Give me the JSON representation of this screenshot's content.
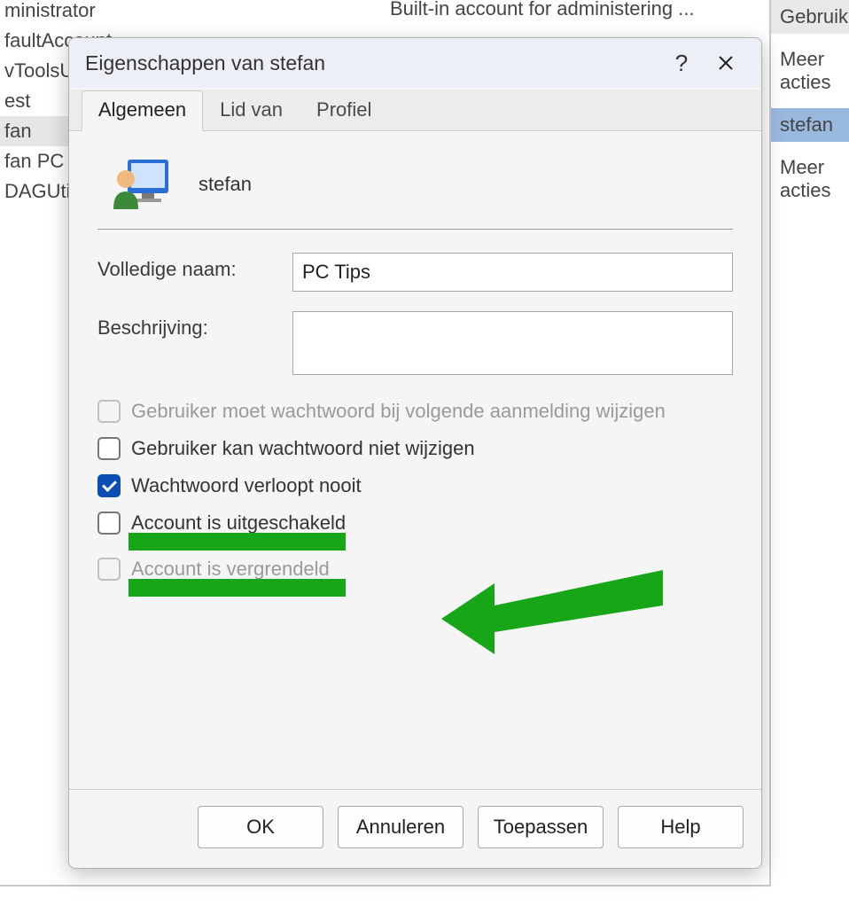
{
  "background": {
    "users": [
      "ministrator",
      "faultAccount",
      "vToolsUser",
      "est",
      "fan",
      "fan PC",
      "DAGUtilityAccount"
    ],
    "selected_index": 4,
    "description_first": "Built-in account for administering ..."
  },
  "right_panel": {
    "header": "Gebruikers",
    "item1": "Meer acties",
    "selected": "stefan",
    "item2": "Meer acties"
  },
  "dialog": {
    "title": "Eigenschappen van stefan",
    "tabs": [
      "Algemeen",
      "Lid van",
      "Profiel"
    ],
    "active_tab": 0,
    "username": "stefan",
    "fields": {
      "full_name_label": "Volledige naam:",
      "full_name_value": "PC Tips",
      "description_label": "Beschrijving:",
      "description_value": ""
    },
    "checkboxes": [
      {
        "label": "Gebruiker moet wachtwoord bij volgende aanmelding wijzigen",
        "checked": false,
        "disabled": true
      },
      {
        "label": "Gebruiker kan wachtwoord niet wijzigen",
        "checked": false,
        "disabled": false
      },
      {
        "label": "Wachtwoord verloopt nooit",
        "checked": true,
        "disabled": false
      },
      {
        "label": "Account is uitgeschakeld",
        "checked": false,
        "disabled": false
      },
      {
        "label": "Account is vergrendeld",
        "checked": false,
        "disabled": true
      }
    ],
    "buttons": {
      "ok": "OK",
      "cancel": "Annuleren",
      "apply": "Toepassen",
      "help": "Help"
    }
  },
  "annotation": {
    "arrow_color": "#18a619"
  }
}
